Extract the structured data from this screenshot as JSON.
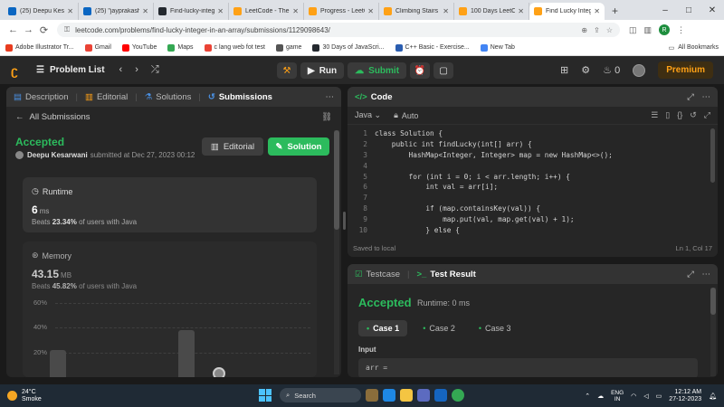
{
  "browser": {
    "tabs": [
      {
        "label": "(25) Deepu Kesa",
        "color": "#0a66c2",
        "active": false
      },
      {
        "label": "(25) \"jayprakash",
        "color": "#0a66c2",
        "active": false
      },
      {
        "label": "Find-lucky-integ",
        "color": "#24292f",
        "active": false
      },
      {
        "label": "LeetCode - The V",
        "color": "#ffa116",
        "active": false
      },
      {
        "label": "Progress - LeetC",
        "color": "#ffa116",
        "active": false
      },
      {
        "label": "Climbing Stairs",
        "color": "#ffa116",
        "active": false
      },
      {
        "label": "100 Days LeetCo",
        "color": "#ffa116",
        "active": false
      },
      {
        "label": "Find Lucky Integ",
        "color": "#ffa116",
        "active": true
      }
    ],
    "new_tab": "+",
    "window_controls": [
      "–",
      "□",
      "✕"
    ],
    "url": "leetcode.com/problems/find-lucky-integer-in-an-array/submissions/1129098643/",
    "profile_initial": "R",
    "bookmarks": [
      {
        "label": "Adobe Illustrator Tr...",
        "color": "#e83c1f"
      },
      {
        "label": "Gmail",
        "color": "#ea4335"
      },
      {
        "label": "YouTube",
        "color": "#ff0000"
      },
      {
        "label": "Maps",
        "color": "#34a853"
      },
      {
        "label": "c lang web fot test",
        "color": "#ea4335"
      },
      {
        "label": "game",
        "color": "#555555"
      },
      {
        "label": "30 Days of JavaScri...",
        "color": "#24292f"
      },
      {
        "label": "C++ Basic - Exercise...",
        "color": "#2a5db0"
      },
      {
        "label": "New Tab",
        "color": "#4285f4"
      }
    ],
    "all_bookmarks": "All Bookmarks"
  },
  "lc_nav": {
    "problem_list": "Problem List",
    "run": "Run",
    "submit": "Submit",
    "streak": "0",
    "premium": "Premium"
  },
  "left": {
    "tabs": {
      "description": "Description",
      "editorial": "Editorial",
      "solutions": "Solutions",
      "submissions": "Submissions"
    },
    "all_submissions": "All Submissions",
    "status": "Accepted",
    "user": "Deepu Kesarwani",
    "submitted_text": "submitted at Dec 27, 2023 00:12",
    "editorial_btn": "Editorial",
    "solution_btn": "Solution",
    "runtime": {
      "title": "Runtime",
      "value": "6",
      "unit": "ms",
      "beats_prefix": "Beats",
      "beats_value": "23.34%",
      "beats_suffix": "of users with Java"
    },
    "memory": {
      "title": "Memory",
      "value": "43.15",
      "unit": "MB",
      "beats_prefix": "Beats",
      "beats_value": "45.82%",
      "beats_suffix": "of users with Java"
    }
  },
  "chart_data": {
    "type": "bar",
    "yticks": [
      "60%",
      "40%",
      "20%"
    ],
    "bars": [
      {
        "x": 1,
        "value": 22
      },
      {
        "x": 2,
        "value": 38
      }
    ],
    "ylim": [
      0,
      60
    ]
  },
  "code": {
    "title": "Code",
    "language": "Java",
    "auto": "Auto",
    "lines": [
      {
        "n": "1",
        "text": "class Solution {"
      },
      {
        "n": "2",
        "text": "    public int findLucky(int[] arr) {"
      },
      {
        "n": "3",
        "text": "        HashMap<Integer, Integer> map = new HashMap<>();"
      },
      {
        "n": "4",
        "text": ""
      },
      {
        "n": "5",
        "text": "        for (int i = 0; i < arr.length; i++) {"
      },
      {
        "n": "6",
        "text": "            int val = arr[i];"
      },
      {
        "n": "7",
        "text": ""
      },
      {
        "n": "8",
        "text": "            if (map.containsKey(val)) {"
      },
      {
        "n": "9",
        "text": "                map.put(val, map.get(val) + 1);"
      },
      {
        "n": "10",
        "text": "            } else {"
      }
    ],
    "saved": "Saved to local",
    "position": "Ln 1, Col 17"
  },
  "result": {
    "testcase_tab": "Testcase",
    "result_tab": "Test Result",
    "status": "Accepted",
    "runtime": "Runtime: 0 ms",
    "cases": [
      "Case 1",
      "Case 2",
      "Case 3"
    ],
    "input_label": "Input",
    "input_value": "arr ="
  },
  "taskbar": {
    "temp": "24°C",
    "weather": "Smoke",
    "search": "Search",
    "lang1": "ENG",
    "lang2": "IN",
    "time": "12:12 AM",
    "date": "27-12-2023"
  },
  "colors": {
    "accent": "#ffa116",
    "success": "#2cbb5d"
  }
}
